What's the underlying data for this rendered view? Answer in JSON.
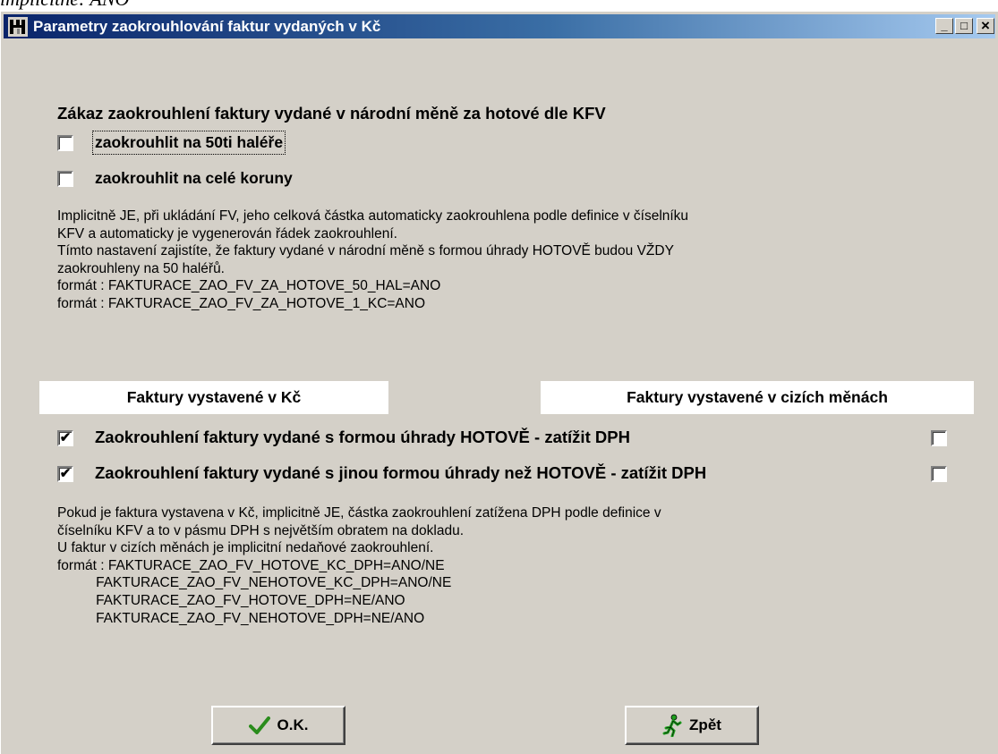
{
  "above_text": "implicitně: ANO",
  "window": {
    "title": "Parametry zaokrouhlování faktur vydaných v Kč",
    "min_glyph": "_",
    "max_glyph": "□",
    "close_glyph": "×"
  },
  "section1": {
    "heading": "Zákaz zaokrouhlení faktury vydané v národní měně za hotové dle KFV",
    "cb_50_label": "zaokrouhlit na 50ti haléře",
    "cb_50_checked": false,
    "cb_koruny_label": "zaokrouhlit na celé koruny",
    "cb_koruny_checked": false,
    "description": "Implicitně JE, při ukládání FV, jeho celková částka automaticky zaokrouhlena podle definice v číselníku\nKFV a automaticky je vygenerován řádek zaokrouhlení.\nTímto nastavení zajistíte, že faktury vydané v národní měně s formou úhrady HOTOVĚ budou VŽDY\nzaokrouhleny na 50 haléřů.\nformát : FAKTURACE_ZAO_FV_ZA_HOTOVE_50_HAL=ANO\nformát : FAKTURACE_ZAO_FV_ZA_HOTOVE_1_KC=ANO"
  },
  "section2": {
    "col_kc": "Faktury vystavené v Kč",
    "col_cizi": "Faktury vystavené v cizích měnách",
    "row1_label": "Zaokrouhlení faktury vydané s formou úhrady HOTOVĚ - zatížit DPH",
    "row1_kc_checked": true,
    "row1_cizi_checked": false,
    "row2_label": "Zaokrouhlení faktury vydané s jinou formou úhrady než HOTOVĚ - zatížit DPH",
    "row2_kc_checked": true,
    "row2_cizi_checked": false,
    "description": "Pokud je faktura vystavena v Kč, implicitně JE, částka zaokrouhlení zatížena DPH podle definice v\nčíselníku KFV a to v pásmu DPH s největším obratem na dokladu.\nU faktur v cizích měnách je implicitní nedaňové zaokrouhlení.\nformát : FAKTURACE_ZAO_FV_HOTOVE_KC_DPH=ANO/NE\n          FAKTURACE_ZAO_FV_NEHOTOVE_KC_DPH=ANO/NE\n          FAKTURACE_ZAO_FV_HOTOVE_DPH=NE/ANO\n          FAKTURACE_ZAO_FV_NEHOTOVE_DPH=NE/ANO"
  },
  "buttons": {
    "ok_label": "O.K.",
    "back_label": "Zpět"
  },
  "colors": {
    "dialog_bg": "#d4d0c8",
    "title_gradient_start": "#0a246a",
    "title_gradient_end": "#a6caf0",
    "ok_check": "#2a8c1c",
    "back_icon": "#1f9e1f"
  }
}
